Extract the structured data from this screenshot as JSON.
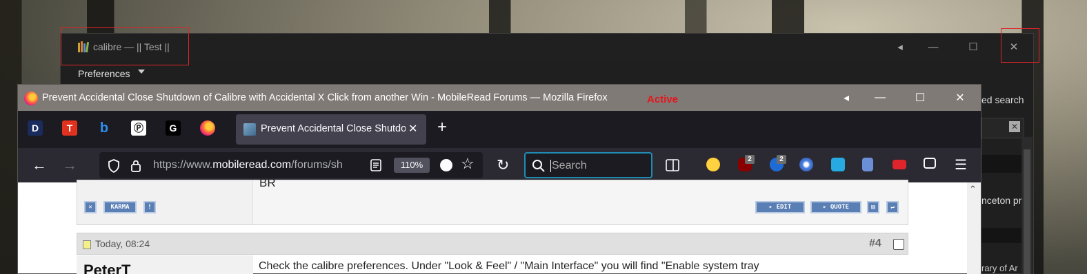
{
  "calibre": {
    "title": "calibre — || Test ||",
    "menu_preferences": "Preferences",
    "side_text_search": "ed search",
    "side_text_book": "nceton pr",
    "side_text_library": "rary of Ar",
    "controls": {
      "back": "◂",
      "minimize": "—",
      "maximize": "☐",
      "close": "✕"
    }
  },
  "firefox": {
    "window_title": "Prevent Accidental Close Shutdown of Calibre with Accidental X Click from another Win - MobileRead Forums — Mozilla Firefox",
    "active_label": "Active",
    "controls": {
      "back": "◂",
      "minimize": "—",
      "maximize": "☐",
      "close": "✕"
    },
    "pinned_tabs": [
      {
        "name": "pinned-tab-d",
        "label": "D",
        "bg": "#1a2b5e",
        "fg": "#ffffff"
      },
      {
        "name": "pinned-tab-t",
        "label": "T",
        "bg": "#e0331f",
        "fg": "#ffffff"
      },
      {
        "name": "pinned-tab-b",
        "label": "b",
        "bg": "#1c1b22",
        "fg": "#2f8ff0"
      },
      {
        "name": "pinned-tab-wiki",
        "label": "Ⓟ",
        "bg": "#ffffff",
        "fg": "#222222"
      },
      {
        "name": "pinned-tab-g",
        "label": "G",
        "bg": "#000000",
        "fg": "#ffffff"
      }
    ],
    "active_tab_title": "Prevent Accidental Close Shutdown of Calibre",
    "url_prefix": "https://www.",
    "url_domain": "mobileread.com",
    "url_path": "/forums/sh",
    "zoom": "110%",
    "search_placeholder": "Search",
    "extensions": [
      {
        "name": "emoji-extension-icon",
        "badge": ""
      },
      {
        "name": "ublock-extension-icon",
        "badge": "2"
      },
      {
        "name": "metamask-extension-icon",
        "badge": "2"
      },
      {
        "name": "blue-circle-extension-icon",
        "badge": ""
      },
      {
        "name": "share-extension-icon",
        "badge": ""
      },
      {
        "name": "bookmark-extension-icon",
        "badge": ""
      },
      {
        "name": "red-extension-icon",
        "badge": ""
      },
      {
        "name": "tab-manager-extension-icon",
        "badge": ""
      }
    ]
  },
  "forum": {
    "post1_fragment": "BR",
    "karma_label": "KARMA",
    "edit_label": "▸ EDIT",
    "quote_label": "▸ QUOTE",
    "post2_date": "Today, 08:24",
    "post2_number": "#4",
    "post2_user": "PeterT",
    "post2_text": "Check the calibre preferences. Under \"Look & Feel\" / \"Main Interface\" you will find \"Enable system tray"
  },
  "colors": {
    "highlight_red": "#e0242b",
    "active_red": "#e8141a",
    "firefox_titlebar": "#807a77",
    "search_focus": "#1f8cb3"
  }
}
